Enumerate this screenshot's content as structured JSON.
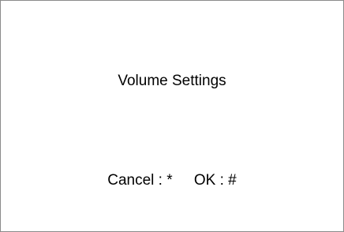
{
  "screen": {
    "title": "Volume Settings",
    "softkeys": {
      "cancel": "Cancel : *",
      "ok": "OK : #"
    }
  }
}
